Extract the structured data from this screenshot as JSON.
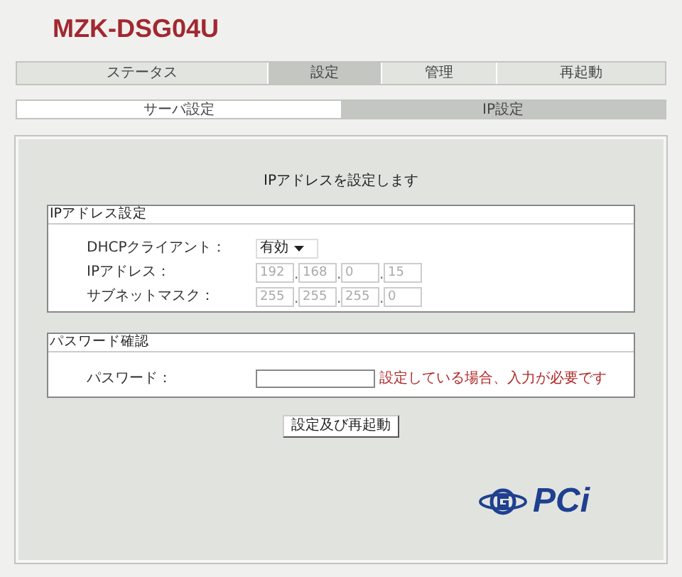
{
  "title": "MZK-DSG04U",
  "tabs": [
    {
      "label": "ステータス",
      "selected": false
    },
    {
      "label": "設定",
      "selected": true
    },
    {
      "label": "管理",
      "selected": false
    },
    {
      "label": "再起動",
      "selected": false
    }
  ],
  "subtabs": [
    {
      "label": "サーバ設定",
      "selected": false
    },
    {
      "label": "IP設定",
      "selected": true
    }
  ],
  "heading": "IPアドレスを設定します",
  "ip_section": {
    "title": "IPアドレス設定",
    "dhcp": {
      "label": "DHCPクライアント：",
      "value": "有効"
    },
    "rows": [
      {
        "label": "IPアドレス：",
        "disabled": true,
        "separator": ".",
        "octets": [
          "192",
          "168",
          "0",
          "15"
        ]
      },
      {
        "label": "サブネットマスク：",
        "disabled": true,
        "separator": ".",
        "octets": [
          "255",
          "255",
          "255",
          "0"
        ]
      }
    ]
  },
  "password_section": {
    "title": "パスワード確認",
    "label": "パスワード：",
    "note": "設定している場合、入力が必要です"
  },
  "submit": "設定及び再起動",
  "logo": "PCi"
}
